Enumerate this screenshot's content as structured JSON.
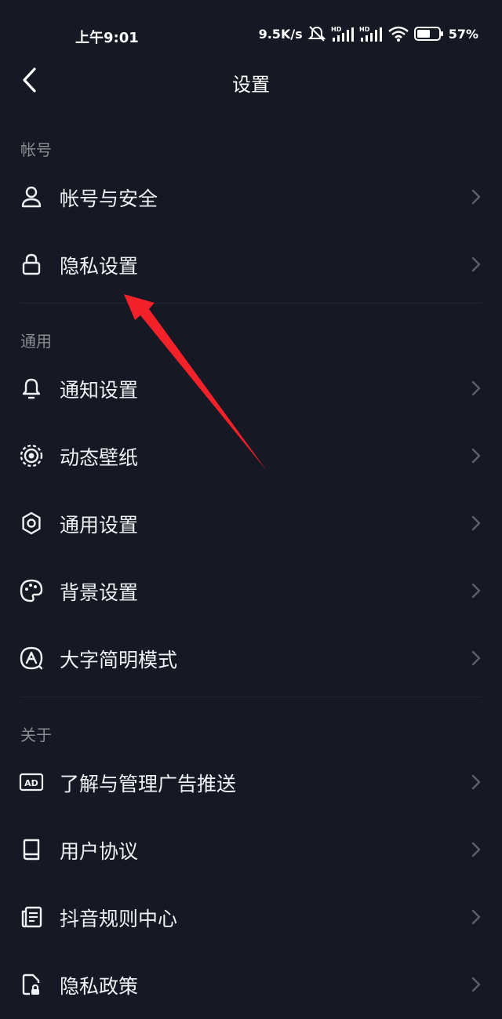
{
  "status_bar": {
    "time": "上午9:01",
    "network_speed": "9.5K/s",
    "battery": "57%"
  },
  "header": {
    "title": "设置",
    "back_icon": "chevron-left-icon"
  },
  "sections": {
    "account": {
      "title": "帐号",
      "items": [
        {
          "label": "帐号与安全",
          "icon": "user-icon"
        },
        {
          "label": "隐私设置",
          "icon": "lock-icon"
        }
      ]
    },
    "general": {
      "title": "通用",
      "items": [
        {
          "label": "通知设置",
          "icon": "bell-icon"
        },
        {
          "label": "动态壁纸",
          "icon": "live-wallpaper-icon"
        },
        {
          "label": "通用设置",
          "icon": "gear-icon"
        },
        {
          "label": "背景设置",
          "icon": "palette-icon"
        },
        {
          "label": "大字简明模式",
          "icon": "large-font-icon"
        }
      ]
    },
    "about": {
      "title": "关于",
      "items": [
        {
          "label": "了解与管理广告推送",
          "icon": "ad-icon"
        },
        {
          "label": "用户协议",
          "icon": "book-icon"
        },
        {
          "label": "抖音规则中心",
          "icon": "document-list-icon"
        },
        {
          "label": "隐私政策",
          "icon": "privacy-document-icon"
        }
      ]
    }
  },
  "colors": {
    "background": "#161823",
    "text": "#f0f1f4",
    "section_title": "#8a8b91",
    "chevron": "#5e5f66",
    "annotation_arrow": "#f2212a"
  }
}
